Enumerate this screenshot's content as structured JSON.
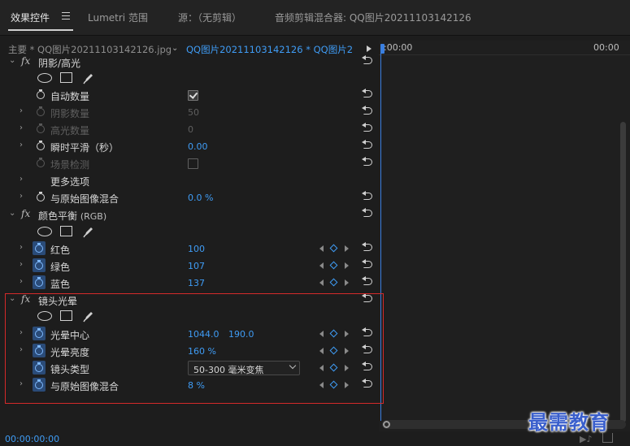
{
  "tabs": [
    {
      "label": "效果控件",
      "active": true
    },
    {
      "label": "Lumetri 范围",
      "active": false
    },
    {
      "label": "源：（无剪辑）",
      "active": false
    },
    {
      "label": "音频剪辑混合器: QQ图片20211103142126",
      "active": false
    }
  ],
  "clip_header": {
    "master_clip": "主要 * QQ图片20211103142126.jpg",
    "sequence_clip": "QQ图片20211103142126 * QQ图片2..."
  },
  "ruler": {
    "start": ":00:00",
    "end": "00:00"
  },
  "shadow_highlight": {
    "title": "阴影/高光",
    "auto_amount": {
      "label": "自动数量",
      "checked": true
    },
    "shadow_amount": {
      "label": "阴影数量",
      "value": "50"
    },
    "highlight_amount": {
      "label": "高光数量",
      "value": "0"
    },
    "temporal_smoothing": {
      "label": "瞬时平滑（秒）",
      "value": "0.00"
    },
    "scene_detect": {
      "label": "场景检测",
      "checked": false
    },
    "more_options": {
      "label": "更多选项"
    },
    "blend_with_original": {
      "label": "与原始图像混合",
      "value": "0.0",
      "unit": "%"
    }
  },
  "color_balance": {
    "title": "颜色平衡",
    "title_suffix": "(RGB)",
    "red": {
      "label": "红色",
      "value": "100"
    },
    "green": {
      "label": "绿色",
      "value": "107"
    },
    "blue": {
      "label": "蓝色",
      "value": "137"
    }
  },
  "lens_flare": {
    "title": "镜头光晕",
    "flare_center": {
      "label": "光晕中心",
      "x": "1044.0",
      "y": "190.0"
    },
    "flare_brightness": {
      "label": "光晕亮度",
      "value": "160",
      "unit": "%"
    },
    "lens_type": {
      "label": "镜头类型",
      "value": "50-300 毫米变焦"
    },
    "blend_with_original": {
      "label": "与原始图像混合",
      "value": "8",
      "unit": "%"
    }
  },
  "status": {
    "timecode": "00:00:00:00"
  },
  "watermark": "最需教育"
}
